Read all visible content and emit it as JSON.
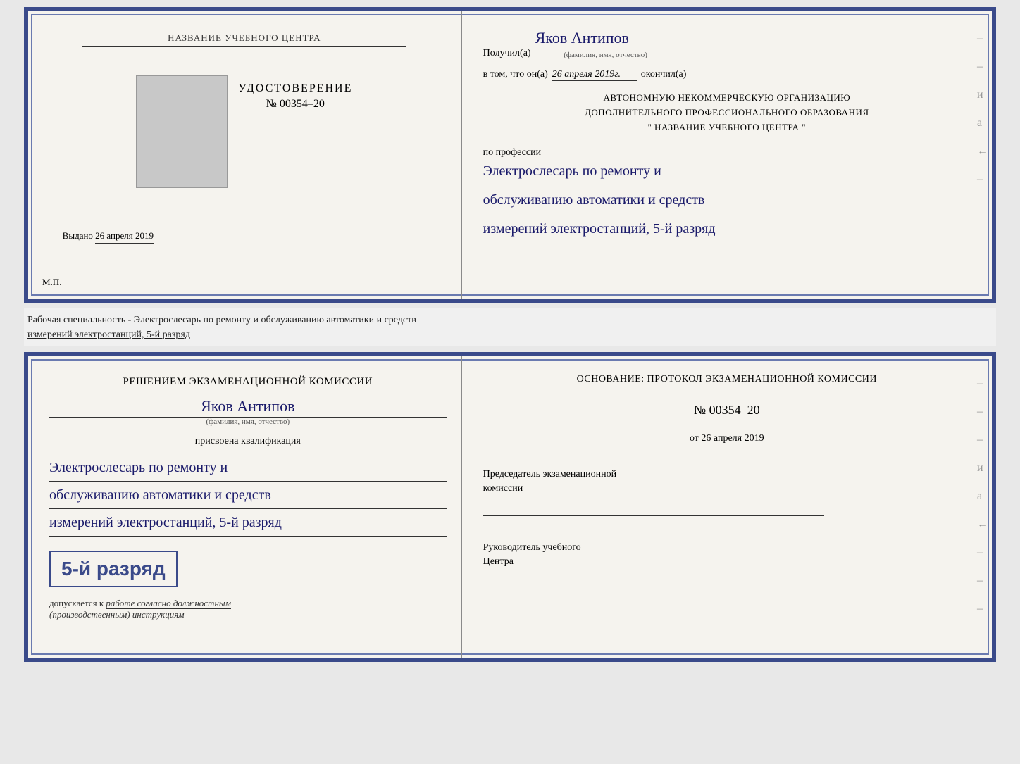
{
  "top_left": {
    "org_name": "НАЗВАНИЕ УЧЕБНОГО ЦЕНТРА",
    "certificate_title": "УДОСТОВЕРЕНИЕ",
    "certificate_number": "№ 00354–20",
    "issued_label": "Выдано",
    "issued_date": "26 апреля 2019",
    "mp_label": "М.П."
  },
  "top_right": {
    "recipient_label": "Получил(а)",
    "recipient_name": "Яков Антипов",
    "fio_subtitle": "(фамилия, имя, отчество)",
    "certifies_label": "в том, что он(а)",
    "certifies_date": "26 апреля 2019г.",
    "finished_label": "окончил(а)",
    "org_line1": "АВТОНОМНУЮ НЕКОММЕРЧЕСКУЮ ОРГАНИЗАЦИЮ",
    "org_line2": "ДОПОЛНИТЕЛЬНОГО ПРОФЕССИОНАЛЬНОГО ОБРАЗОВАНИЯ",
    "org_quote": "\" НАЗВАНИЕ УЧЕБНОГО ЦЕНТРА \"",
    "profession_label": "по профессии",
    "profession_line1": "Электрослесарь по ремонту и",
    "profession_line2": "обслуживанию автоматики и средств",
    "profession_line3": "измерений электростанций, 5-й разряд"
  },
  "info_strip": {
    "line1": "Рабочая специальность - Электрослесарь по ремонту и обслуживанию автоматики и средств",
    "line2": "измерений электростанций, 5-й разряд"
  },
  "bottom_left": {
    "decision_text": "Решением экзаменационной комиссии",
    "person_name": "Яков Антипов",
    "fio_subtitle": "(фамилия, имя, отчество)",
    "qualification_label": "присвоена квалификация",
    "qual_line1": "Электрослесарь по ремонту и",
    "qual_line2": "обслуживанию автоматики и средств",
    "qual_line3": "измерений электростанций, 5-й разряд",
    "grade_text": "5-й разряд",
    "admission_prefix": "допускается к",
    "admission_italic": "работе согласно должностным",
    "admission_italic2": "(производственным) инструкциям"
  },
  "bottom_right": {
    "basis_label": "Основание: протокол экзаменационной комиссии",
    "protocol_number": "№ 00354–20",
    "date_from_label": "от",
    "date_from_value": "26 апреля 2019",
    "chairman_title1": "Председатель экзаменационной",
    "chairman_title2": "комиссии",
    "director_title1": "Руководитель учебного",
    "director_title2": "Центра"
  },
  "deco": {
    "dash": "–",
    "and_label": "и",
    "a_label": "а",
    "left_arrow": "←"
  }
}
